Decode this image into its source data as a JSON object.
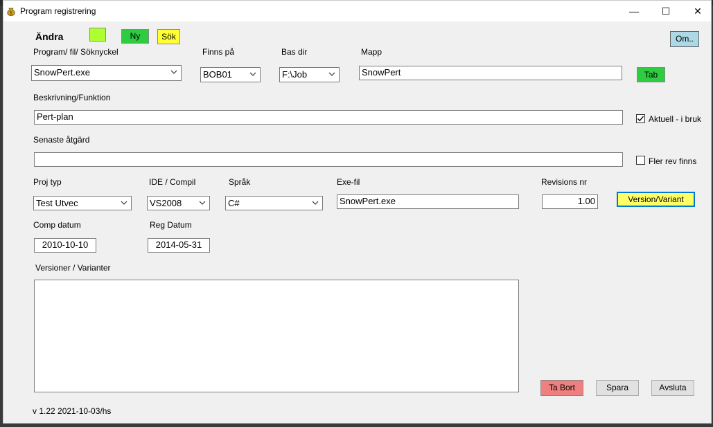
{
  "window": {
    "title": "Program registrering",
    "minimize_glyph": "—",
    "maximize_glyph": "☐",
    "close_glyph": "✕"
  },
  "header": {
    "mode_label": "Ändra",
    "new_label": "Ny",
    "search_label": "Sök",
    "about_label": "Om.."
  },
  "form": {
    "program_label": "Program/ fil/ Söknyckel",
    "program_value": "SnowPert.exe",
    "finns_pa_label": "Finns på",
    "finns_pa_value": "BOB01",
    "bas_dir_label": "Bas dir",
    "bas_dir_value": "F:\\Job",
    "mapp_label": "Mapp",
    "mapp_value": "SnowPert",
    "tab_label": "Tab",
    "beskrivning_label": "Beskrivning/Funktion",
    "beskrivning_value": "Pert-plan",
    "aktuell_label": "Aktuell - i bruk",
    "aktuell_checked": true,
    "senaste_label": "Senaste åtgärd",
    "senaste_value": "",
    "fler_rev_label": "Fler rev finns",
    "fler_rev_checked": false,
    "proj_typ_label": "Proj typ",
    "proj_typ_value": "Test Utvec",
    "ide_label": "IDE / Compil",
    "ide_value": "VS2008",
    "sprak_label": "Språk",
    "sprak_value": "C#",
    "exe_fil_label": "Exe-fil",
    "exe_fil_value": "SnowPert.exe",
    "revisions_label": "Revisions nr",
    "revisions_value": "1.00",
    "version_button_label": "Version/Variant",
    "comp_datum_label": "Comp datum",
    "comp_datum_value": "2010-10-10",
    "reg_datum_label": "Reg Datum",
    "reg_datum_value": "2014-05-31",
    "versioner_label": "Versioner / Varianter",
    "versioner_value": ""
  },
  "actions": {
    "delete_label": "Ta Bort",
    "save_label": "Spara",
    "exit_label": "Avsluta"
  },
  "footer": {
    "version_text": "v 1.22 2021-10-03/hs"
  },
  "colors": {
    "status_green": "#adff2f",
    "new_green": "#2ecc40",
    "search_yellow": "#ffff33",
    "about_blue": "#add8e6",
    "tab_green": "#2ecc40",
    "version_yellow": "#ffff66",
    "version_border": "#0078d7",
    "delete_red": "#f08080"
  }
}
